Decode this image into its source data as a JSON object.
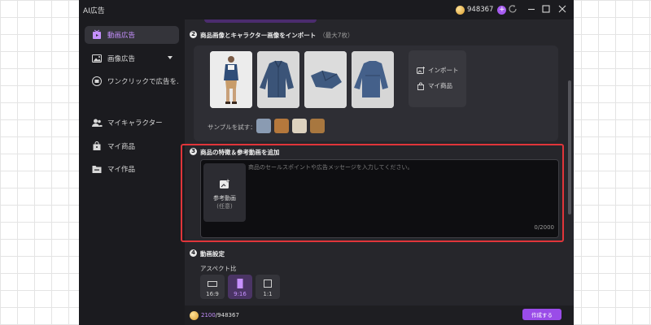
{
  "titlebar": {
    "title": "AI広告",
    "credits": "948367",
    "add_credits": "+"
  },
  "sidebar": {
    "items": [
      {
        "label": "動画広告",
        "icon": "video-ad-icon"
      },
      {
        "label": "画像広告",
        "icon": "image-ad-icon"
      },
      {
        "label": "ワンクリックで広告を...",
        "icon": "one-click-ad-icon"
      },
      {
        "label": "マイキャラクター",
        "icon": "character-icon"
      },
      {
        "label": "マイ商品",
        "icon": "product-bag-icon"
      },
      {
        "label": "マイ作品",
        "icon": "folder-icon"
      }
    ]
  },
  "step2": {
    "number": "2",
    "title": "商品画像とキャラクター画像をインポート",
    "hint": "（最大7枚）",
    "import_label": "インポート",
    "my_products_label": "マイ商品",
    "sample_label": "サンプルを試す："
  },
  "step3": {
    "number": "3",
    "title": "商品の特徴＆参考動画を追加",
    "ref_video_label": "参考動画",
    "ref_video_optional": "(任意)",
    "placeholder": "商品のセールスポイントや広告メッセージを入力してください。",
    "char_count": "0/2000"
  },
  "step4": {
    "number": "4",
    "title": "動画設定",
    "aspect_label": "アスペクト比",
    "ratios": [
      {
        "label": "16:9",
        "selected": false
      },
      {
        "label": "9:16",
        "selected": true
      },
      {
        "label": "1:1",
        "selected": false
      }
    ]
  },
  "footer": {
    "cost": "2100",
    "total": "/948367",
    "create_label": "作成する"
  },
  "colors": {
    "accent": "#9a4ce8",
    "active_text": "#c690ff",
    "highlight_border": "#e0353a",
    "window_bg": "#1b1b1f",
    "panel_bg": "#26262b"
  }
}
